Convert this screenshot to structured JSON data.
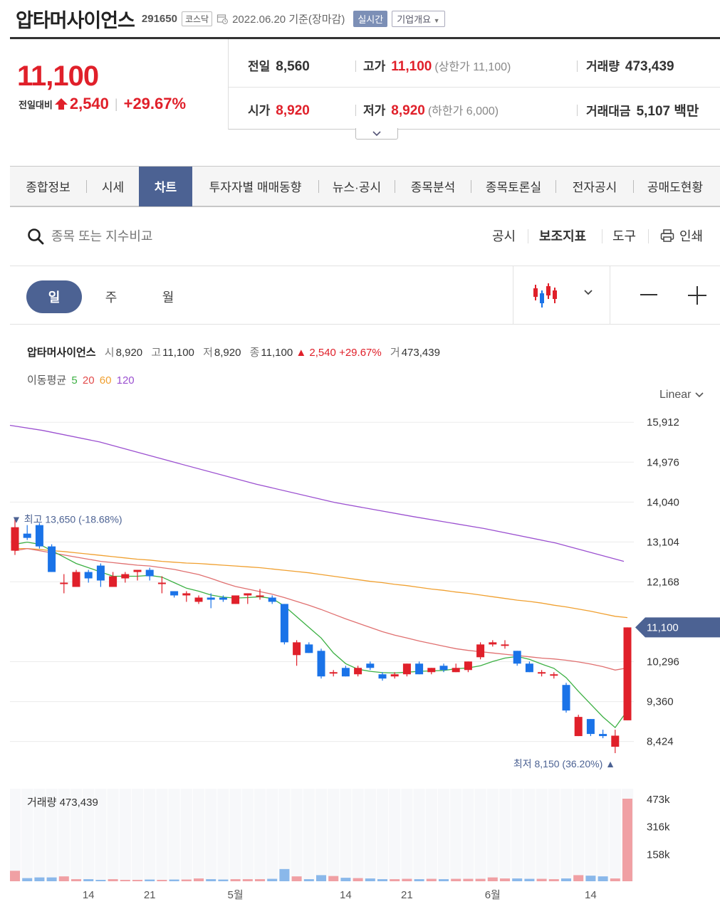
{
  "stock": {
    "name": "압타머사이언스",
    "code": "291650",
    "market": "코스닥",
    "date": "2022.06.20 기준(장마감)",
    "realtime_btn": "실시간",
    "company_btn": "기업개요"
  },
  "quote": {
    "price": "11,100",
    "diff_label": "전일대비",
    "diff": "2,540",
    "diff_pct": "+29.67%",
    "prev_label": "전일",
    "prev": "8,560",
    "high_label": "고가",
    "high": "11,100",
    "upper_limit": "(상한가 11,100)",
    "volume_label": "거래량",
    "volume": "473,439",
    "open_label": "시가",
    "open": "8,920",
    "low_label": "저가",
    "low": "8,920",
    "lower_limit": "(하한가 6,000)",
    "amount_label": "거래대금",
    "amount": "5,107 백만"
  },
  "tabs": [
    "종합정보",
    "시세",
    "차트",
    "투자자별 매매동향",
    "뉴스·공시",
    "종목분석",
    "종목토론실",
    "전자공시",
    "공매도현황"
  ],
  "active_tab": "차트",
  "tools": {
    "search_placeholder": "종목 또는 지수비교",
    "disclosure": "공시",
    "indicators": "보조지표",
    "drawing": "도구",
    "print": "인쇄"
  },
  "periods": [
    "일",
    "주",
    "월"
  ],
  "active_period": "일",
  "chart_info": {
    "name": "압타머사이언스",
    "open_label": "시",
    "open": "8,920",
    "high_label": "고",
    "high": "11,100",
    "low_label": "저",
    "low": "8,920",
    "close_label": "종",
    "close": "11,100",
    "change": "▲ 2,540",
    "change_pct": "+29.67%",
    "volume_label": "거",
    "volume": "473,439"
  },
  "ma_legend": {
    "label": "이동평균",
    "items": [
      {
        "period": "5",
        "color": "#3cb043"
      },
      {
        "period": "20",
        "color": "#e24b4b"
      },
      {
        "period": "60",
        "color": "#f0a030"
      },
      {
        "period": "120",
        "color": "#9b50d0"
      }
    ]
  },
  "scale": "Linear",
  "volume_label": "거래량 473,439",
  "colors": {
    "up": "#e0202a",
    "down": "#1a73e8",
    "accent": "#4c6293"
  },
  "chart_data": {
    "type": "candlestick",
    "yticks": [
      8424,
      9360,
      10296,
      11100,
      12168,
      13104,
      14040,
      14976,
      15912
    ],
    "ytick_labels": [
      "8,424",
      "9,360",
      "10,296",
      "11,100",
      "12,168",
      "13,104",
      "14,040",
      "14,976",
      "15,912"
    ],
    "current_price_label": "11,100",
    "ylim": [
      7950,
      16300
    ],
    "high_annotation": "▼ 최고 13,650 (-18.68%)",
    "low_annotation": "최저 8,150 (36.20%) ▲",
    "xtick_labels": [
      {
        "index": 6,
        "label": "14"
      },
      {
        "index": 11,
        "label": "21"
      },
      {
        "index": 18,
        "label": "5월"
      },
      {
        "index": 27,
        "label": "14"
      },
      {
        "index": 32,
        "label": "21"
      },
      {
        "index": 39,
        "label": "6월"
      },
      {
        "index": 47,
        "label": "14"
      }
    ],
    "candles": [
      {
        "o": 12900,
        "h": 13650,
        "l": 12800,
        "c": 13450
      },
      {
        "o": 13300,
        "h": 13500,
        "l": 13150,
        "c": 13200
      },
      {
        "o": 13500,
        "h": 13550,
        "l": 12950,
        "c": 13000
      },
      {
        "o": 13000,
        "h": 13050,
        "l": 12400,
        "c": 12400
      },
      {
        "o": 12150,
        "h": 12350,
        "l": 11900,
        "c": 12150
      },
      {
        "o": 12050,
        "h": 12450,
        "l": 12050,
        "c": 12400
      },
      {
        "o": 12400,
        "h": 12450,
        "l": 12150,
        "c": 12250
      },
      {
        "o": 12550,
        "h": 12600,
        "l": 12050,
        "c": 12200
      },
      {
        "o": 12050,
        "h": 12400,
        "l": 12050,
        "c": 12300
      },
      {
        "o": 12250,
        "h": 12400,
        "l": 12150,
        "c": 12350
      },
      {
        "o": 12400,
        "h": 12450,
        "l": 12200,
        "c": 12450
      },
      {
        "o": 12450,
        "h": 12500,
        "l": 12200,
        "c": 12300
      },
      {
        "o": 12150,
        "h": 12300,
        "l": 11900,
        "c": 12150
      },
      {
        "o": 11950,
        "h": 11950,
        "l": 11800,
        "c": 11850
      },
      {
        "o": 11850,
        "h": 11950,
        "l": 11700,
        "c": 11900
      },
      {
        "o": 11700,
        "h": 11850,
        "l": 11650,
        "c": 11800
      },
      {
        "o": 11800,
        "h": 11900,
        "l": 11550,
        "c": 11750
      },
      {
        "o": 11800,
        "h": 11850,
        "l": 11700,
        "c": 11750
      },
      {
        "o": 11650,
        "h": 11850,
        "l": 11650,
        "c": 11850
      },
      {
        "o": 11850,
        "h": 11900,
        "l": 11650,
        "c": 11900
      },
      {
        "o": 11850,
        "h": 12000,
        "l": 11750,
        "c": 11850
      },
      {
        "o": 11800,
        "h": 11850,
        "l": 11650,
        "c": 11700
      },
      {
        "o": 11650,
        "h": 11650,
        "l": 10700,
        "c": 10750
      },
      {
        "o": 10450,
        "h": 10800,
        "l": 10200,
        "c": 10750
      },
      {
        "o": 10700,
        "h": 10750,
        "l": 10500,
        "c": 10500
      },
      {
        "o": 10550,
        "h": 10600,
        "l": 9900,
        "c": 9950
      },
      {
        "o": 10050,
        "h": 10100,
        "l": 9950,
        "c": 10050
      },
      {
        "o": 10150,
        "h": 10200,
        "l": 9950,
        "c": 9950
      },
      {
        "o": 10000,
        "h": 10200,
        "l": 9950,
        "c": 10150
      },
      {
        "o": 10250,
        "h": 10300,
        "l": 10100,
        "c": 10150
      },
      {
        "o": 10000,
        "h": 10050,
        "l": 9850,
        "c": 9900
      },
      {
        "o": 9950,
        "h": 10050,
        "l": 9900,
        "c": 10000
      },
      {
        "o": 10000,
        "h": 10250,
        "l": 9950,
        "c": 10250
      },
      {
        "o": 10250,
        "h": 10300,
        "l": 10000,
        "c": 10000
      },
      {
        "o": 10050,
        "h": 10150,
        "l": 10000,
        "c": 10150
      },
      {
        "o": 10200,
        "h": 10250,
        "l": 10050,
        "c": 10100
      },
      {
        "o": 10050,
        "h": 10250,
        "l": 10050,
        "c": 10150
      },
      {
        "o": 10100,
        "h": 10300,
        "l": 10050,
        "c": 10300
      },
      {
        "o": 10400,
        "h": 10750,
        "l": 10350,
        "c": 10700
      },
      {
        "o": 10700,
        "h": 10800,
        "l": 10650,
        "c": 10750
      },
      {
        "o": 10700,
        "h": 10800,
        "l": 10600,
        "c": 10700
      },
      {
        "o": 10550,
        "h": 10550,
        "l": 10200,
        "c": 10250
      },
      {
        "o": 10250,
        "h": 10300,
        "l": 10050,
        "c": 10050
      },
      {
        "o": 10050,
        "h": 10100,
        "l": 9950,
        "c": 10050
      },
      {
        "o": 10000,
        "h": 10050,
        "l": 9900,
        "c": 10000
      },
      {
        "o": 9750,
        "h": 9800,
        "l": 9100,
        "c": 9150
      },
      {
        "o": 8550,
        "h": 9050,
        "l": 8550,
        "c": 9000
      },
      {
        "o": 8950,
        "h": 8950,
        "l": 8550,
        "c": 8600
      },
      {
        "o": 8600,
        "h": 8700,
        "l": 8500,
        "c": 8550
      },
      {
        "o": 8300,
        "h": 8700,
        "l": 8150,
        "c": 8560
      },
      {
        "o": 8920,
        "h": 11100,
        "l": 8920,
        "c": 11100
      }
    ],
    "ma5": [
      13050,
      13100,
      13050,
      12900,
      12750,
      12600,
      12500,
      12400,
      12300,
      12300,
      12300,
      12320,
      12280,
      12150,
      12020,
      11950,
      11860,
      11810,
      11790,
      11800,
      11820,
      11780,
      11600,
      11350,
      11100,
      10850,
      10500,
      10250,
      10120,
      10070,
      10040,
      10030,
      10050,
      10070,
      10080,
      10090,
      10130,
      10150,
      10200,
      10300,
      10380,
      10420,
      10350,
      10240,
      10140,
      9920,
      9600,
      9300,
      9000,
      8750,
      9150
    ],
    "ma20": [
      12900,
      12950,
      12900,
      12850,
      12800,
      12750,
      12700,
      12650,
      12620,
      12590,
      12560,
      12540,
      12500,
      12460,
      12400,
      12340,
      12250,
      12150,
      12060,
      12000,
      11940,
      11880,
      11800,
      11710,
      11620,
      11520,
      11410,
      11300,
      11200,
      11100,
      11000,
      10920,
      10850,
      10780,
      10720,
      10660,
      10600,
      10560,
      10530,
      10500,
      10470,
      10440,
      10410,
      10380,
      10360,
      10330,
      10290,
      10240,
      10180,
      10100,
      10150
    ],
    "ma60": [
      12950,
      12950,
      12930,
      12900,
      12880,
      12850,
      12820,
      12790,
      12760,
      12730,
      12700,
      12680,
      12650,
      12630,
      12610,
      12600,
      12580,
      12560,
      12540,
      12520,
      12500,
      12470,
      12440,
      12410,
      12380,
      12340,
      12300,
      12260,
      12220,
      12180,
      12150,
      12110,
      12080,
      12040,
      12000,
      11970,
      11930,
      11900,
      11860,
      11820,
      11780,
      11740,
      11710,
      11670,
      11620,
      11580,
      11530,
      11480,
      11420,
      11360,
      11330
    ],
    "ma120": [
      null,
      null,
      null,
      null,
      null,
      null,
      null,
      null,
      null,
      null,
      null,
      null,
      null,
      null,
      null,
      null,
      null,
      null,
      null,
      null,
      null,
      null,
      null,
      null,
      null,
      null,
      null,
      null,
      null,
      null,
      null,
      null,
      null,
      null,
      null,
      null,
      null,
      null,
      null,
      null,
      null,
      null,
      null,
      null,
      null,
      null,
      null,
      null,
      null,
      null,
      null
    ],
    "ma120_path": "purple line falling from ~15,840 to ~12,650",
    "volume": {
      "yticks": [
        158000,
        316000,
        473000
      ],
      "ytick_labels": [
        "158k",
        "316k",
        "473k"
      ],
      "values": [
        60000,
        18000,
        22000,
        22000,
        28000,
        12000,
        12000,
        8000,
        12000,
        8000,
        8000,
        10000,
        8000,
        10000,
        10000,
        16000,
        12000,
        10000,
        12000,
        12000,
        12000,
        14000,
        70000,
        28000,
        12000,
        35000,
        30000,
        20000,
        18000,
        16000,
        12000,
        12000,
        14000,
        12000,
        14000,
        12000,
        14000,
        14000,
        14000,
        22000,
        16000,
        16000,
        14000,
        14000,
        12000,
        16000,
        35000,
        32000,
        28000,
        16000,
        473439
      ]
    }
  }
}
